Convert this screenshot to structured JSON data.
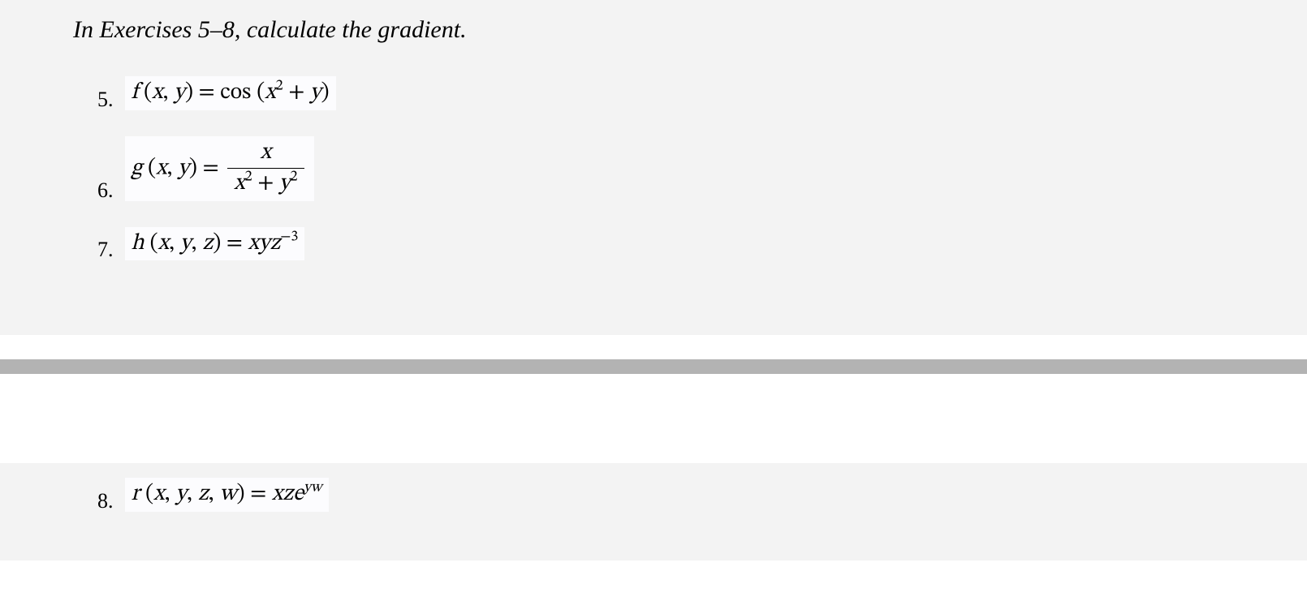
{
  "instruction": "In Exercises 5–8, calculate the gradient.",
  "problems": {
    "p5": {
      "num": "5.",
      "f": "f",
      "args": "(x, y)",
      "eq": " = cos ",
      "rhs_open": "(",
      "term1_var": "x",
      "term1_exp": "2",
      "plus": " + ",
      "term2_var": "y",
      "rhs_close": ")"
    },
    "p6": {
      "num": "6.",
      "f": "g",
      "args": "(x, y)",
      "eq": " = ",
      "num_var": "x",
      "den_v1": "x",
      "den_e1": "2",
      "den_plus": " + ",
      "den_v2": "y",
      "den_e2": "2"
    },
    "p7": {
      "num": "7.",
      "f": "h",
      "args": "(x, y, z)",
      "eq": " = ",
      "rhs_vars": "xyz",
      "rhs_exp": "−3"
    },
    "p8": {
      "num": "8.",
      "f": "r",
      "args": "(x, y, z, w)",
      "eq": " = ",
      "rhs_v1": "xze",
      "rhs_exp": "yw"
    }
  }
}
